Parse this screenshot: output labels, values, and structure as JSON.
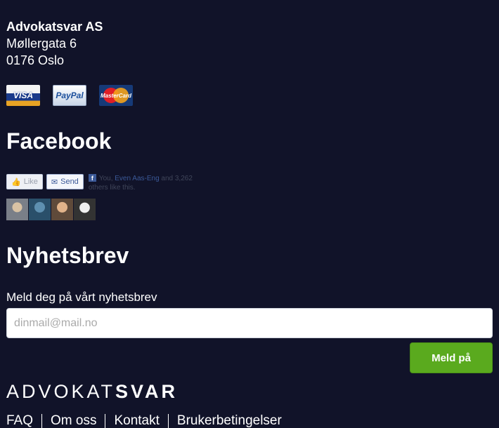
{
  "company": {
    "name": "Advokatsvar AS",
    "street": "Møllergata 6",
    "city": "0176 Oslo"
  },
  "payments": [
    {
      "name": "visa-icon",
      "label": "VISA"
    },
    {
      "name": "paypal-icon",
      "label": "PayPal"
    },
    {
      "name": "mastercard-icon",
      "label": "MasterCard"
    }
  ],
  "facebook": {
    "heading": "Facebook",
    "like_label": "Like",
    "send_label": "Send",
    "text_prefix": "You,",
    "friend": "Even Aas-Eng",
    "text_suffix": "and 3,262 others like this."
  },
  "newsletter": {
    "heading": "Nyhetsbrev",
    "label": "Meld deg på vårt nyhetsbrev",
    "placeholder": "dinmail@mail.no",
    "button": "Meld på"
  },
  "logo": {
    "part1": "ADVOKAT",
    "part2": "SVAR"
  },
  "footer": {
    "links": [
      "FAQ",
      "Om oss",
      "Kontakt",
      "Brukerbetingelser"
    ]
  },
  "colors": {
    "background": "#111329",
    "button": "#5aaa1e",
    "facebook": "#3b5998"
  }
}
